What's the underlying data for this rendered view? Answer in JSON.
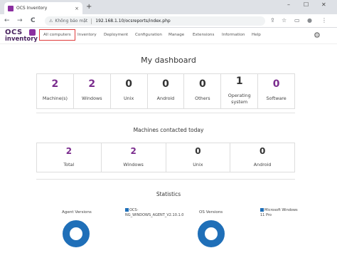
{
  "browser": {
    "tab_title": "OCS Inventory",
    "tab_close": "×",
    "new_tab": "+",
    "win_min": "–",
    "win_max": "☐",
    "win_close": "✕",
    "back": "←",
    "forward": "→",
    "reload": "C",
    "security_icon": "⚠",
    "security_text": "Không bảo mật",
    "url": "192.168.1.10/ocsreports/index.php",
    "toolbar_share": "⇪",
    "toolbar_star": "☆",
    "toolbar_split": "▭",
    "toolbar_profile": "●",
    "toolbar_menu": "⋮"
  },
  "app": {
    "logo_top": "OCS",
    "logo_bottom": "inventory",
    "nav": [
      {
        "label": "All computers",
        "active": true
      },
      {
        "label": "Inventory"
      },
      {
        "label": "Deployment"
      },
      {
        "label": "Configuration"
      },
      {
        "label": "Manage"
      },
      {
        "label": "Extensions"
      },
      {
        "label": "Information"
      },
      {
        "label": "Help"
      }
    ],
    "settings_icon": "⚙"
  },
  "dashboard": {
    "title": "My dashboard",
    "stats": [
      {
        "value": "2",
        "label": "Machine(s)"
      },
      {
        "value": "2",
        "label": "Windows"
      },
      {
        "value": "0",
        "label": "Unix"
      },
      {
        "value": "0",
        "label": "Android"
      },
      {
        "value": "0",
        "label": "Others"
      },
      {
        "value": "1",
        "label": "Operating system"
      },
      {
        "value": "0",
        "label": "Software"
      }
    ],
    "contacted_title": "Machines contacted today",
    "contacted": [
      {
        "value": "2",
        "label": "Total"
      },
      {
        "value": "2",
        "label": "Windows"
      },
      {
        "value": "0",
        "label": "Unix"
      },
      {
        "value": "0",
        "label": "Android"
      }
    ],
    "statistics_title": "Statistics",
    "agent_versions": {
      "title": "Agent Versions",
      "legend": "OCS-NG_WINDOWS_AGENT_V2.10.1.0",
      "color": "#1f6fb8"
    },
    "os_versions": {
      "title": "OS Versions",
      "legend": "Microsoft Windows 11 Pro",
      "color": "#1f6fb8"
    }
  }
}
